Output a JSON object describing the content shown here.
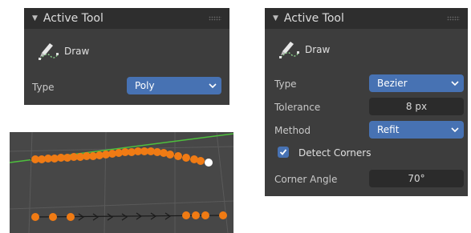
{
  "panel_small": {
    "header_title": "Active Tool",
    "tool_name": "Draw",
    "type_label": "Type",
    "type_value": "Poly"
  },
  "panel_large": {
    "header_title": "Active Tool",
    "tool_name": "Draw",
    "type_label": "Type",
    "type_value": "Bezier",
    "tolerance_label": "Tolerance",
    "tolerance_value": "8 px",
    "method_label": "Method",
    "method_value": "Refit",
    "detect_corners_label": "Detect Corners",
    "detect_corners_checked": true,
    "corner_angle_label": "Corner Angle",
    "corner_angle_value": "70°"
  },
  "icons": {
    "collapse": "triangle-down-icon",
    "grip": "drag-grip-icon",
    "draw_tool": "pencil-curve-icon",
    "dropdown": "chevron-down-icon",
    "checkbox": "checkmark-icon"
  },
  "colors": {
    "panel_bg": "#3d3d3d",
    "header_bg": "#2e2e2e",
    "accent": "#4772b3",
    "field_bg": "#2b2b2b",
    "viewport_bg": "#474747",
    "point_orange": "#f07b14",
    "x_axis_green": "#4ec03d"
  }
}
